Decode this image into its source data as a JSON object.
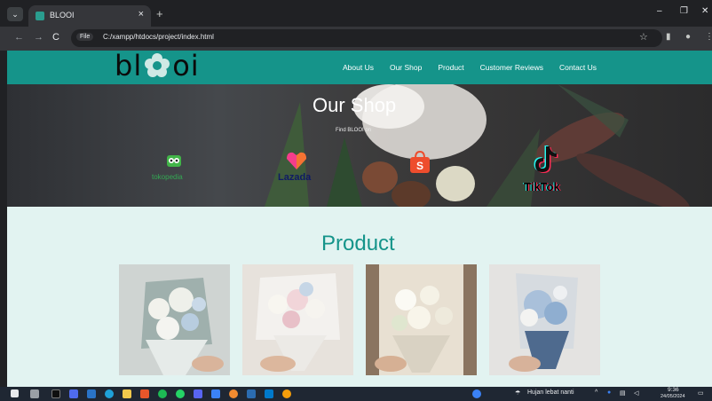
{
  "browser": {
    "tab_title": "BLOOI",
    "url": "C:/xampp/htdocs/project/index.html",
    "file_chip": "File",
    "buttons": {
      "tab_close": "×",
      "new_tab": "+",
      "minimize": "–",
      "maximize": "❐",
      "close": "✕",
      "back": "←",
      "forward": "→",
      "reload": "C",
      "star": "☆",
      "tab_switch": "⌄"
    }
  },
  "site": {
    "logo_left": "bl",
    "logo_right": "oi",
    "nav": [
      "About Us",
      "Our Shop",
      "Product",
      "Customer Reviews",
      "Contact Us"
    ]
  },
  "hero": {
    "title": "Our Shop",
    "subtitle": "Find BLOOI on",
    "shops": [
      "tokopedia",
      "Lazada",
      "",
      "TikTok"
    ]
  },
  "product": {
    "title": "Product",
    "cards": [
      {
        "icon": "bouquet-white-blue"
      },
      {
        "icon": "bouquet-pink-white"
      },
      {
        "icon": "bouquet-cream"
      },
      {
        "icon": "bouquet-blue-hydrangea"
      }
    ]
  },
  "taskbar": {
    "weather": "Hujan lebat nanti",
    "time": "9:36",
    "date": "24/05/2024"
  },
  "colors": {
    "brand": "#15948a",
    "section_bg": "#e2f3f1"
  }
}
